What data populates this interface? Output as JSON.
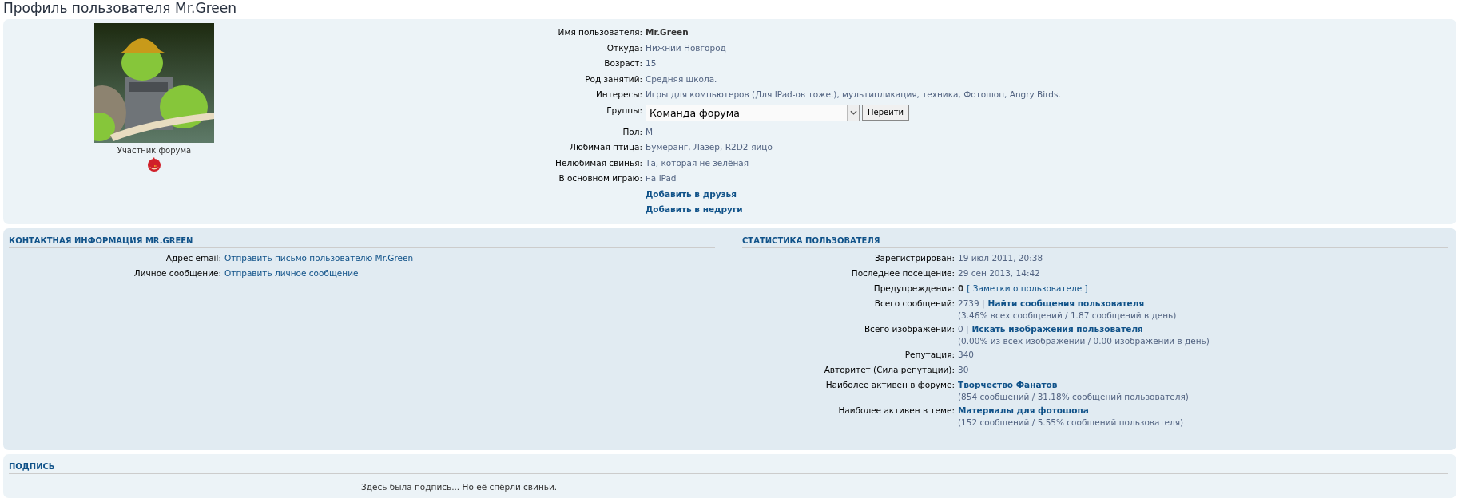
{
  "title": "Профиль пользователя Mr.Green",
  "profile": {
    "rank": "Участник форума",
    "fields": [
      {
        "label": "Имя пользователя:",
        "value": "Mr.Green",
        "kind": "bold"
      },
      {
        "label": "Откуда:",
        "value": "Нижний Новгород",
        "kind": "text"
      },
      {
        "label": "Возраст:",
        "value": "15",
        "kind": "text"
      },
      {
        "label": "Род занятий:",
        "value": "Средняя школа.",
        "kind": "text"
      },
      {
        "label": "Интересы:",
        "value": "Игры для компьютеров (Для IPad-ов тоже.), мультипликация, техника, Фотошоп, Angry Birds.",
        "kind": "text"
      },
      {
        "label": "Группы:",
        "value": "Команда форума",
        "button": "Перейти",
        "kind": "select"
      },
      {
        "label": "Пол:",
        "value": "М",
        "kind": "text"
      },
      {
        "label": "Любимая птица:",
        "value": "Бумеранг, Лазер, R2D2-яйцо",
        "kind": "text"
      },
      {
        "label": "Нелюбимая свинья:",
        "value": "Та, которая не зелёная",
        "kind": "text"
      },
      {
        "label": "В основном играю:",
        "value": "на iPad",
        "kind": "text"
      }
    ],
    "links": [
      "Добавить в друзья",
      "Добавить в недруги"
    ]
  },
  "contact": {
    "title": "КОНТАКТНАЯ ИНФОРМАЦИЯ MR.GREEN",
    "rows": [
      {
        "label": "Адрес email:",
        "value": "Отправить письмо пользователю Mr.Green"
      },
      {
        "label": "Личное сообщение:",
        "value": "Отправить личное сообщение"
      }
    ]
  },
  "stats": {
    "title": "СТАТИСТИКА ПОЛЬЗОВАТЕЛЯ",
    "rows": [
      {
        "label": "Зарегистрирован:",
        "parts": [
          {
            "text": "19 июл 2011, 20:38",
            "kind": "plain"
          }
        ]
      },
      {
        "label": "Последнее посещение:",
        "parts": [
          {
            "text": "29 сен 2013, 14:42",
            "kind": "plain"
          }
        ]
      },
      {
        "label": "Предупреждения:",
        "parts": [
          {
            "text": "0",
            "kind": "bold"
          },
          {
            "text": "[ Заметки о пользователе ]",
            "kind": "link"
          }
        ]
      },
      {
        "label": "Всего сообщений:",
        "parts": [
          {
            "text": "2739 |",
            "kind": "plain"
          },
          {
            "text": "Найти сообщения пользователя",
            "kind": "strong_link"
          }
        ],
        "note": "(3.46% всех сообщений / 1.87 сообщений в день)"
      },
      {
        "label": "Всего изображений:",
        "parts": [
          {
            "text": "0 |",
            "kind": "plain"
          },
          {
            "text": "Искать изображения пользователя",
            "kind": "strong_link"
          }
        ],
        "note": "(0.00% из всех изображений / 0.00 изображений в день)"
      },
      {
        "label": "Репутация:",
        "parts": [
          {
            "text": "340",
            "kind": "plain"
          }
        ]
      },
      {
        "label": "Авторитет (Сила репутации):",
        "parts": [
          {
            "text": "30",
            "kind": "plain"
          }
        ]
      },
      {
        "label": "Наиболее активен в форуме:",
        "parts": [
          {
            "text": "Творчество Фанатов",
            "kind": "strong_link"
          }
        ],
        "note": "(854 сообщений / 31.18% сообщений пользователя)"
      },
      {
        "label": "Наиболее активен в теме:",
        "parts": [
          {
            "text": "Материалы для фотошопа",
            "kind": "strong_link"
          }
        ],
        "note": "(152 сообщений / 5.55% сообщений пользователя)"
      }
    ]
  },
  "signature": {
    "title": "ПОДПИСЬ",
    "text": "Здесь была подпись... Но её спёрли свиньи."
  }
}
